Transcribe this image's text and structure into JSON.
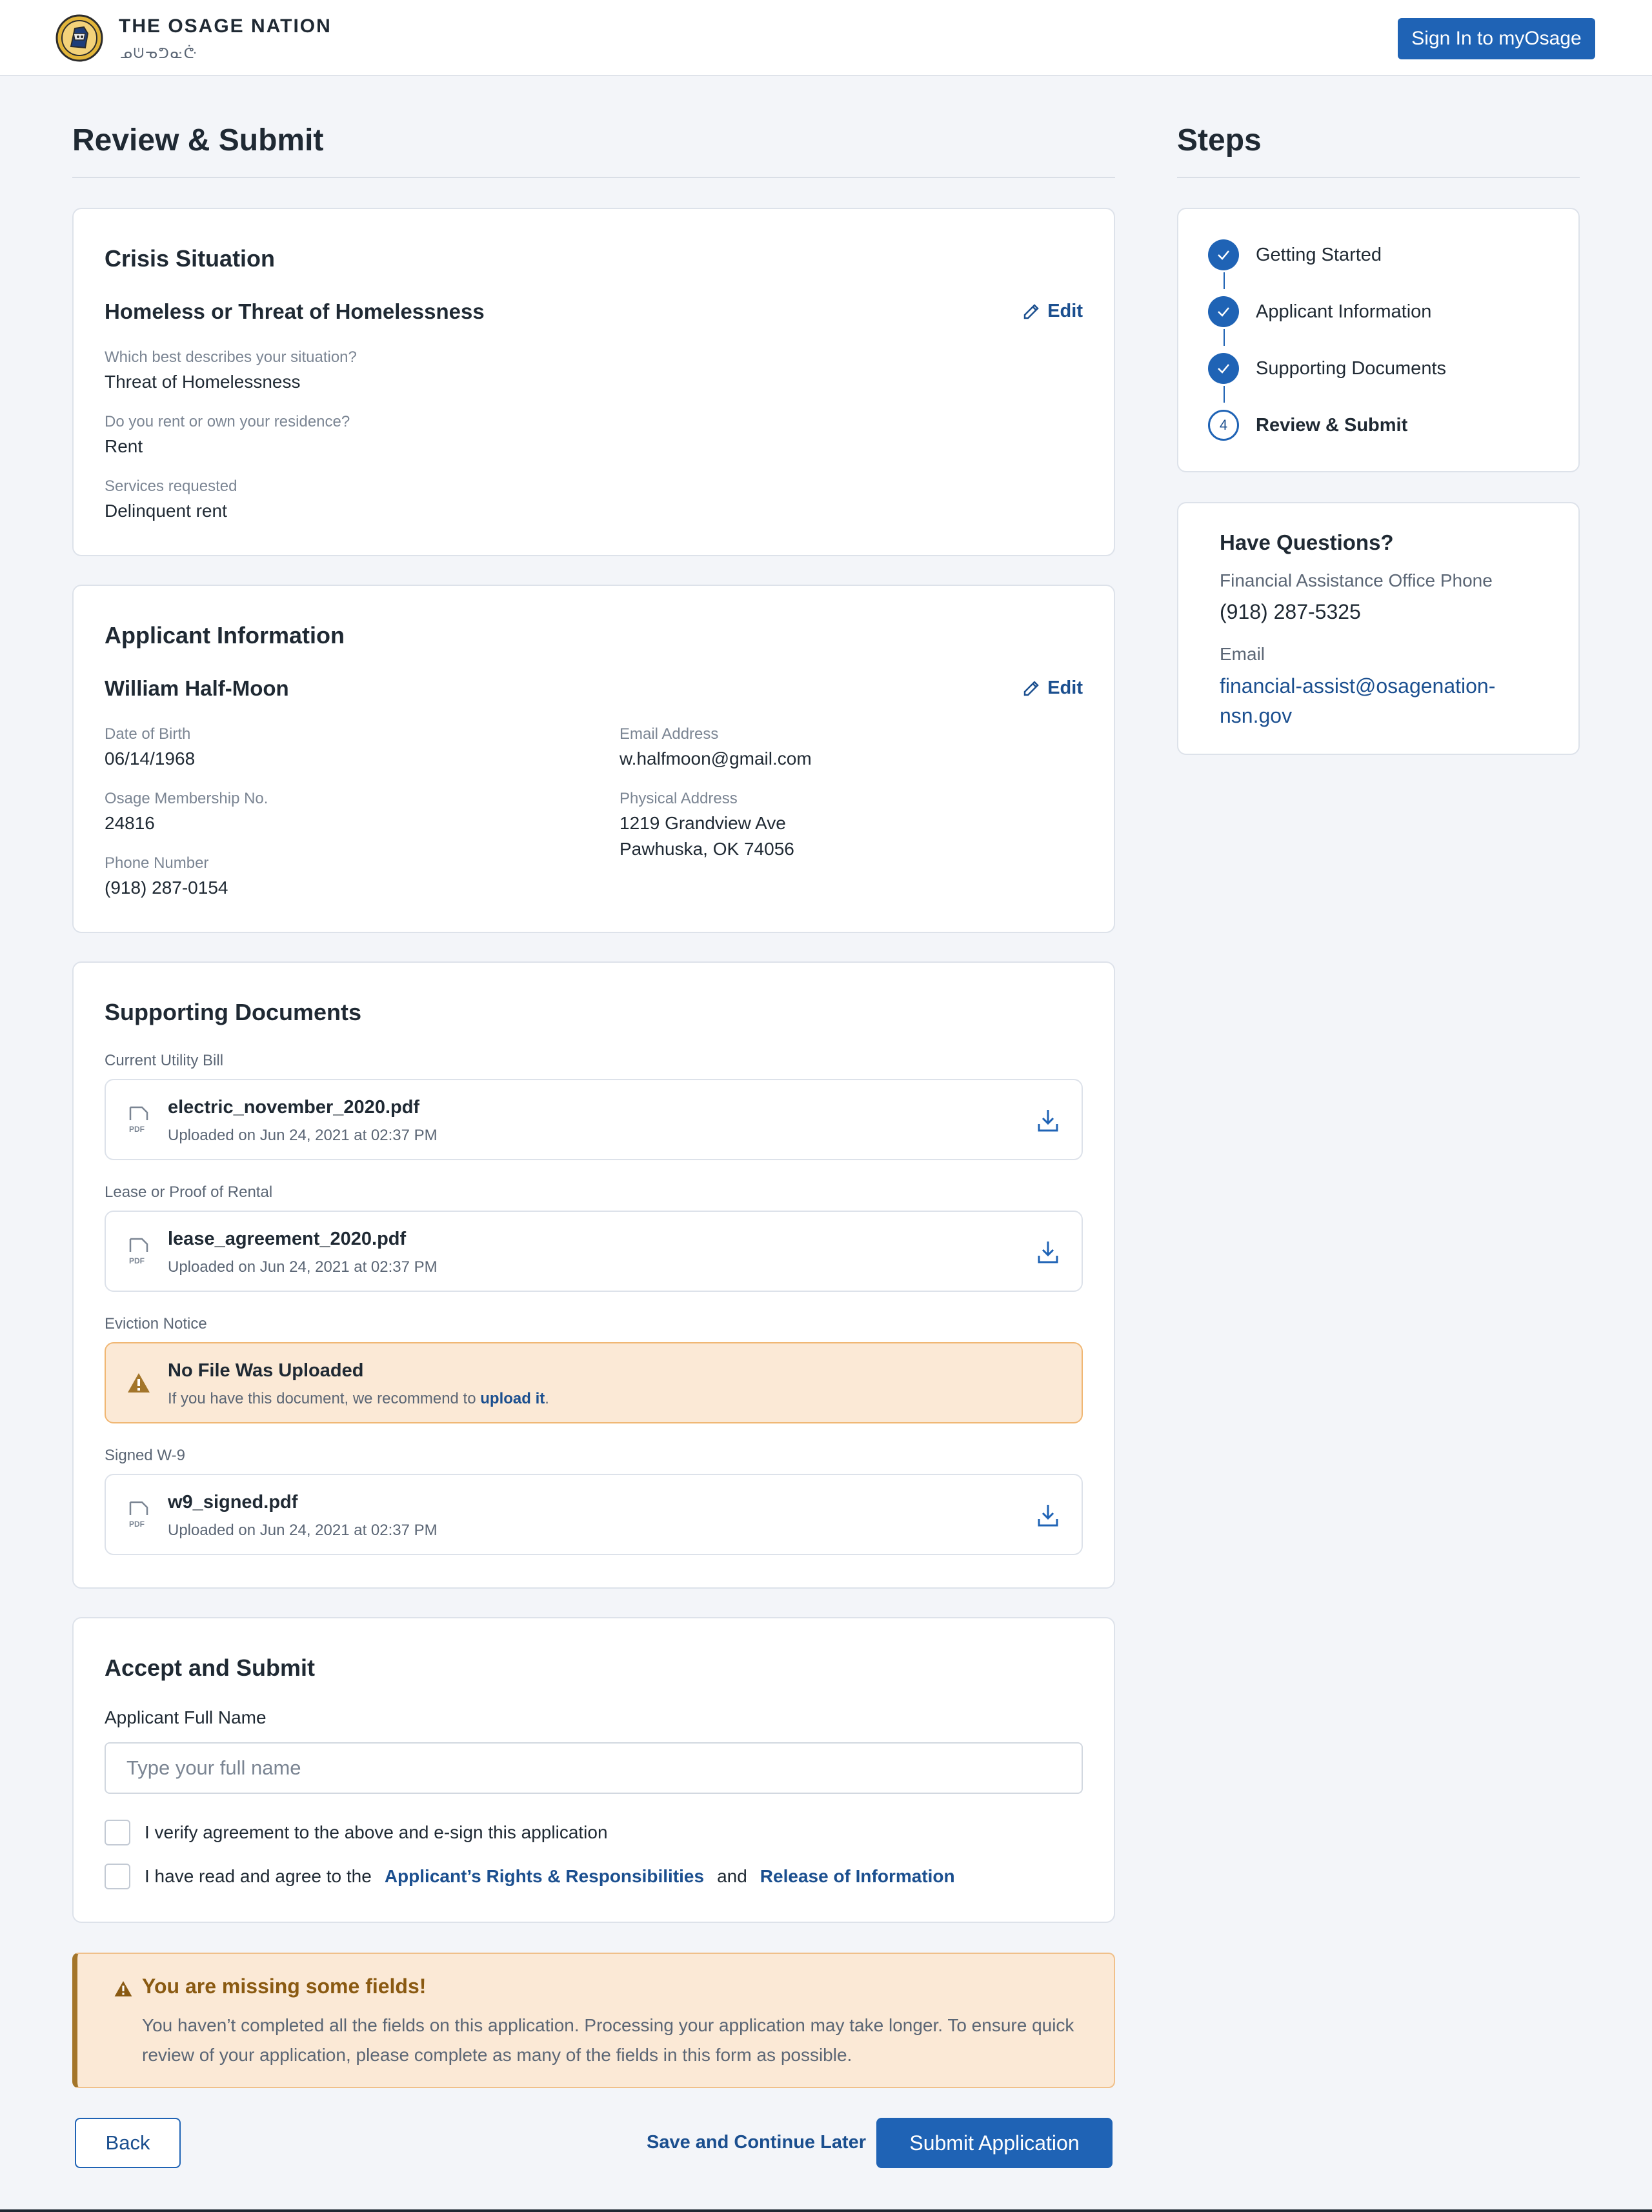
{
  "header": {
    "org_name": "THE OSAGE NATION",
    "org_sub": "ᓄᕫᓀᕤᓌᕩ",
    "signin_label": "Sign In to myOsage"
  },
  "page_title": "Review & Submit",
  "crisis": {
    "title": "Crisis Situation",
    "subtitle": "Homeless or Threat of Homelessness",
    "edit_label": "Edit",
    "fields": [
      {
        "label": "Which best describes your situation?",
        "value": "Threat of Homelessness"
      },
      {
        "label": "Do you rent or own your residence?",
        "value": "Rent"
      },
      {
        "label": "Services requested",
        "value": "Delinquent rent"
      }
    ]
  },
  "applicant": {
    "title": "Applicant Information",
    "name": "William Half-Moon",
    "edit_label": "Edit",
    "dob_label": "Date of Birth",
    "dob": "06/14/1968",
    "membership_label": "Osage Membership No.",
    "membership": "24816",
    "phone_label": "Phone Number",
    "phone": "(918) 287-0154",
    "email_label": "Email Address",
    "email": "w.halfmoon@gmail.com",
    "address_label": "Physical Address",
    "address_line1": "1219 Grandview Ave",
    "address_line2": "Pawhuska, OK 74056"
  },
  "documents": {
    "title": "Supporting Documents",
    "items": [
      {
        "label": "Current Utility Bill",
        "file": "electric_november_2020.pdf",
        "meta": "Uploaded on Jun 24, 2021 at 02:37 PM"
      },
      {
        "label": "Lease or Proof of Rental",
        "file": "lease_agreement_2020.pdf",
        "meta": "Uploaded on Jun 24, 2021 at 02:37 PM"
      },
      {
        "label": "Eviction Notice",
        "warning_title": "No File Was Uploaded",
        "warning_text": "If you have this document, we recommend to ",
        "warning_link": "upload it",
        "warning_end": "."
      },
      {
        "label": "Signed W-9",
        "file": "w9_signed.pdf",
        "meta": "Uploaded on Jun 24, 2021 at 02:37 PM"
      }
    ],
    "pdf_tag": "PDF"
  },
  "accept": {
    "title": "Accept and Submit",
    "name_label": "Applicant Full Name",
    "name_placeholder": "Type your full name",
    "name_value": "",
    "check1": "I verify agreement to the above and e-sign this application",
    "check2_prefix": "I have read and agree to the",
    "check2_link1": "Applicant’s Rights & Responsibilities",
    "check2_and": "and",
    "check2_link2": "Release of Information"
  },
  "alert": {
    "title": "You are missing some fields!",
    "text": "You haven’t completed all the fields on this application. Processing your application may take longer. To ensure quick review of your application, please complete as many of the fields in this form as possible."
  },
  "actions": {
    "back": "Back",
    "save_later": "Save and Continue Later",
    "submit": "Submit Application"
  },
  "steps": {
    "title": "Steps",
    "items": [
      {
        "label": "Getting Started",
        "state": "done"
      },
      {
        "label": "Applicant Information",
        "state": "done"
      },
      {
        "label": "Supporting Documents",
        "state": "done"
      },
      {
        "label": "Review & Submit",
        "state": "current",
        "number": "4"
      }
    ]
  },
  "questions": {
    "title": "Have Questions?",
    "phone_label": "Financial Assistance Office Phone",
    "phone": "(918) 287-5325",
    "email_label": "Email",
    "email": "financial-assist@osagenation-nsn.gov"
  },
  "colors": {
    "primary": "#1f63b5",
    "link": "#1b4f8f",
    "warning_bg": "#fbe9d6",
    "warning_border": "#f0b774",
    "page_bg": "#f3f5f9"
  }
}
